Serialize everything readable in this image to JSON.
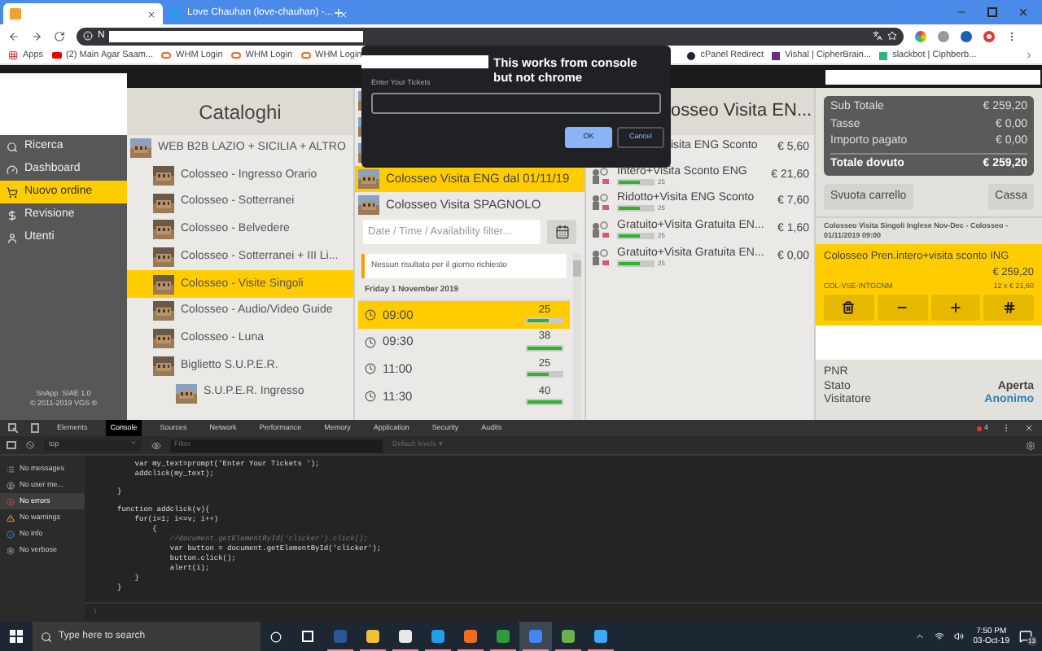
{
  "browser": {
    "tabs": [
      {
        "selected": true
      },
      {
        "title": "Love Chauhan (love-chauhan) -...",
        "selected": false
      }
    ],
    "url": "N",
    "bookmarks": [
      "Apps",
      "(2) Main Agar Saam...",
      "WHM Login",
      "WHM Login",
      "WHM Login"
    ],
    "bookmarks_right": [
      "cPanel Redirect",
      "Vishal | CipherBrain...",
      "slackbot | Ciphberb..."
    ]
  },
  "dialog": {
    "annotation": "This works from console but not chrome",
    "label": "Enter Your Tickets",
    "ok": "OK",
    "cancel": "Cancel"
  },
  "sidebar": {
    "items": [
      {
        "label": "Ricerca",
        "selected": false
      },
      {
        "label": "Dashboard",
        "selected": false
      },
      {
        "label": "Nuovo ordine",
        "selected": true
      },
      {
        "label": "Revisione",
        "selected": false
      },
      {
        "label": "Utenti",
        "selected": false
      }
    ],
    "footer": [
      "SnApp  SIAE 1.0",
      "© 2011-2019 VGS ®"
    ]
  },
  "catalog": {
    "title": "Cataloghi",
    "items": [
      {
        "label": "WEB B2B LAZIO + SICILIA + ALTRO",
        "selected": false,
        "children": [
          {
            "label": "Colosseo - Ingresso Orario",
            "selected": false
          },
          {
            "label": "Colosseo - Sotterranei",
            "selected": false
          },
          {
            "label": "Colosseo - Belvedere",
            "selected": false
          },
          {
            "label": "Colosseo - Sotterranei + III Li...",
            "selected": false
          },
          {
            "label": "Colosseo - Visite Singoli",
            "selected": true
          },
          {
            "label": "Colosseo - Audio/Video Guide",
            "selected": false
          },
          {
            "label": "Colosseo - Luna",
            "selected": false
          },
          {
            "label": "Biglietto S.U.P.E.R.",
            "selected": false,
            "children": [
              {
                "label": "S.U.P.E.R. Ingresso",
                "selected": false
              }
            ]
          }
        ]
      }
    ]
  },
  "products": {
    "items": [
      {
        "kind": "covered"
      },
      {
        "kind": "covered"
      },
      {
        "kind": "covered"
      },
      {
        "kind": "full",
        "label": "Colosseo Visita ENG dal 01/11/19",
        "selected": true
      },
      {
        "kind": "full",
        "label": "Colosseo Visita SPAGNOLO",
        "selected": false
      }
    ],
    "filter_placeholder": "Date / Time / Availability filter...",
    "notice": "Nessun risultato per il giorno richiesto",
    "day": "Friday 1 November 2019",
    "slots": [
      {
        "time": "09:00",
        "count": "25",
        "level": 0.6,
        "selected": true
      },
      {
        "time": "09:30",
        "count": "38",
        "level": 1,
        "selected": false
      },
      {
        "time": "11:00",
        "count": "25",
        "level": 0.6,
        "selected": false
      },
      {
        "time": "11:30",
        "count": "40",
        "level": 1,
        "selected": false
      }
    ]
  },
  "prices": {
    "title": "osseo Visita EN...",
    "rows": [
      {
        "kind": "covered",
        "name": "isita ENG Sconto",
        "price": "€ 5,60"
      },
      {
        "kind": "full",
        "name": "Intero+Visita Sconto ENG",
        "count": "25",
        "level": 0.6,
        "price": "€ 21,60"
      },
      {
        "kind": "full",
        "name": "Ridotto+Visita ENG Sconto",
        "count": "25",
        "level": 0.6,
        "price": "€ 7,60"
      },
      {
        "kind": "full",
        "name": "Gratuito+Visita Gratuita EN...",
        "count": "25",
        "level": 0.6,
        "price": "€ 1,60"
      },
      {
        "kind": "full",
        "name": "Gratuito+Visita Gratuita EN...",
        "count": "25",
        "level": 0.6,
        "price": "€ 0,00"
      }
    ]
  },
  "cart": {
    "summary": [
      {
        "label": "Sub Totale",
        "value": "€ 259,20",
        "total": false
      },
      {
        "label": "Tasse",
        "value": "€ 0,00",
        "total": false
      },
      {
        "label": "Importo pagato",
        "value": "€ 0,00",
        "total": false
      },
      {
        "label": "Totale dovuto",
        "value": "€ 259,20",
        "total": true
      }
    ],
    "clear": "Svuota carrello",
    "checkout": "Cassa",
    "description": "Colosseo Visita Singoli Inglese Nov-Dec - Colosseo - 01/11/2019 09:00",
    "item": {
      "title": "Colosseo Pren.intero+visita sconto ING",
      "price": "€ 259,20",
      "code": "COL-VSE-INTGCNM",
      "qty": "12 x € 21,60"
    },
    "info": [
      {
        "label": "PNR"
      },
      {
        "label": "Stato",
        "value": "Aperta",
        "link": false
      },
      {
        "label": "Visitatore",
        "value": "Anonimo",
        "link": true
      }
    ]
  },
  "devtools": {
    "tabs": [
      {
        "label": "Elements",
        "selected": false
      },
      {
        "label": "Console",
        "selected": true
      },
      {
        "label": "Sources",
        "selected": false
      },
      {
        "label": "Network",
        "selected": false
      },
      {
        "label": "Performance",
        "selected": false
      },
      {
        "label": "Memory",
        "selected": false
      },
      {
        "label": "Application",
        "selected": false
      },
      {
        "label": "Security",
        "selected": false
      },
      {
        "label": "Audits",
        "selected": false
      }
    ],
    "error_count": "4",
    "context": "top",
    "filter_placeholder": "Filter",
    "levels": "Default levels ▾",
    "filters": [
      {
        "label": "No messages",
        "selected": false
      },
      {
        "label": "No user me...",
        "selected": false
      },
      {
        "label": "No errors",
        "selected": true
      },
      {
        "label": "No warnings",
        "selected": false
      },
      {
        "label": "No info",
        "selected": false
      },
      {
        "label": "No verbose",
        "selected": false
      }
    ],
    "code_blocks": [
      [
        {
          "text": "    var my_text=prompt('Enter Your Tickets ');",
          "kind": "code"
        },
        {
          "text": "    addclick(my_text);",
          "kind": "code"
        }
      ],
      [
        {
          "text": "}",
          "kind": "code"
        }
      ],
      [
        {
          "text": "function addclick(v){",
          "kind": "code"
        },
        {
          "text": "    for(i=1; i<=v; i++)",
          "kind": "code"
        },
        {
          "text": "        {",
          "kind": "code"
        },
        {
          "text": "            //document.getElementById('clicker').click();",
          "kind": "comment"
        },
        {
          "text": "            var button = document.getElementById('clicker');",
          "kind": "code"
        },
        {
          "text": "            button.click();",
          "kind": "code"
        },
        {
          "text": "            alert(i);",
          "kind": "code"
        },
        {
          "text": "    }",
          "kind": "code"
        },
        {
          "text": "}",
          "kind": "code"
        }
      ]
    ]
  },
  "taskbar": {
    "search_placeholder": "Type here to search",
    "apps": [
      {
        "running": true,
        "selected": false
      },
      {
        "running": true,
        "selected": false
      },
      {
        "running": true,
        "selected": false
      },
      {
        "running": true,
        "selected": false
      },
      {
        "running": true,
        "selected": false
      },
      {
        "running": true,
        "selected": false
      },
      {
        "running": true,
        "selected": true
      },
      {
        "running": true,
        "selected": false
      },
      {
        "running": true,
        "selected": false
      }
    ],
    "time": "7:50 PM",
    "date": "03-Oct-19",
    "notifications": "13"
  }
}
